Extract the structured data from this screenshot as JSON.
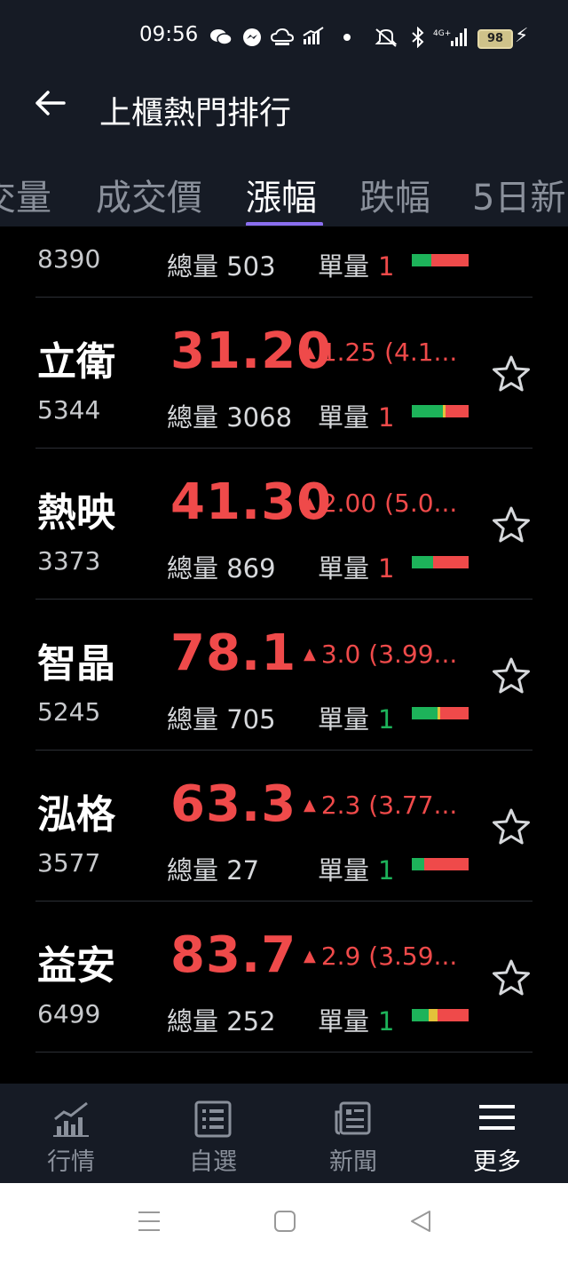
{
  "status_bar": {
    "time": "09:56",
    "battery": "98"
  },
  "header": {
    "title": "上櫃熱門排行"
  },
  "tabs": [
    {
      "label": "交量"
    },
    {
      "label": "成交價"
    },
    {
      "label": "漲幅"
    },
    {
      "label": "跌幅"
    },
    {
      "label": "5日新"
    }
  ],
  "active_tab": "漲幅",
  "labels": {
    "volume": "總量",
    "unit": "單量"
  },
  "rows": [
    {
      "name": "",
      "code": "8390",
      "price": "",
      "change": "",
      "volume": "503",
      "unit": "1",
      "unit_color": "#ef4a4a",
      "bar": [
        0.35,
        0.65
      ],
      "bar_colors": [
        "#1db35a",
        "#ef4a4a"
      ]
    },
    {
      "name": "立衛",
      "code": "5344",
      "price": "31.20",
      "change": "1.25 (4.1...",
      "volume": "3068",
      "unit": "1",
      "unit_color": "#ef4a4a",
      "bar": [
        0.55,
        0.05,
        0.4
      ],
      "bar_colors": [
        "#1db35a",
        "#e3c23a",
        "#ef4a4a"
      ]
    },
    {
      "name": "熱映",
      "code": "3373",
      "price": "41.30",
      "change": "2.00 (5.0...",
      "volume": "869",
      "unit": "1",
      "unit_color": "#ef4a4a",
      "bar": [
        0.38,
        0.62
      ],
      "bar_colors": [
        "#1db35a",
        "#ef4a4a"
      ]
    },
    {
      "name": "智晶",
      "code": "5245",
      "price": "78.1",
      "change": "3.0 (3.99...",
      "volume": "705",
      "unit": "1",
      "unit_color": "#1db35a",
      "bar": [
        0.45,
        0.05,
        0.5
      ],
      "bar_colors": [
        "#1db35a",
        "#e3c23a",
        "#ef4a4a"
      ]
    },
    {
      "name": "泓格",
      "code": "3577",
      "price": "63.3",
      "change": "2.3 (3.77...",
      "volume": "27",
      "unit": "1",
      "unit_color": "#1db35a",
      "bar": [
        0.22,
        0.78
      ],
      "bar_colors": [
        "#1db35a",
        "#ef4a4a"
      ]
    },
    {
      "name": "益安",
      "code": "6499",
      "price": "83.7",
      "change": "2.9 (3.59...",
      "volume": "252",
      "unit": "1",
      "unit_color": "#1db35a",
      "bar": [
        0.3,
        0.15,
        0.55
      ],
      "bar_colors": [
        "#1db35a",
        "#e3c23a",
        "#ef4a4a"
      ]
    }
  ],
  "price_color": "#ef4a4a",
  "bottom_nav": [
    {
      "label": "行情",
      "icon": "chart-icon",
      "active": false
    },
    {
      "label": "自選",
      "icon": "list-icon",
      "active": false
    },
    {
      "label": "新聞",
      "icon": "news-icon",
      "active": false
    },
    {
      "label": "更多",
      "icon": "menu-icon",
      "active": true
    }
  ]
}
